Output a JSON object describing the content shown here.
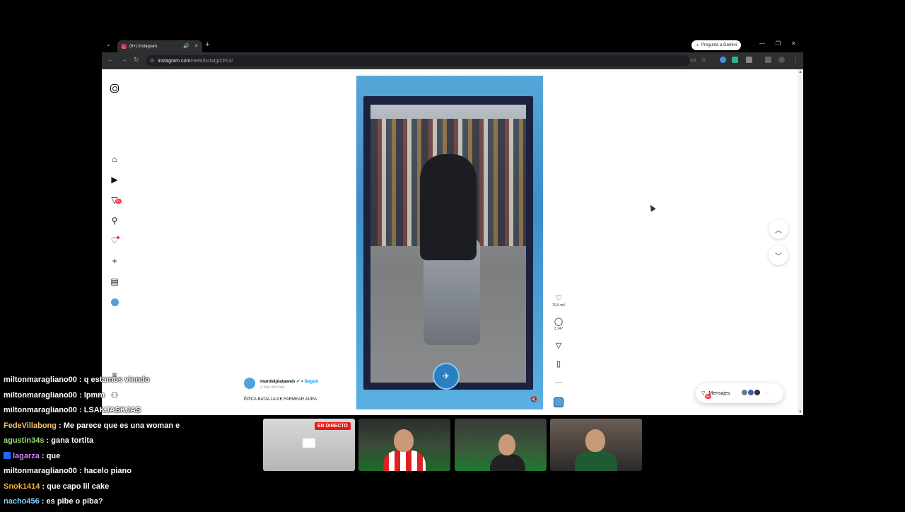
{
  "browser": {
    "tab_title": "(9+) Instagram",
    "gemini_label": "Pregunta a Gemini",
    "url_host": "instagram.com",
    "url_path": "/reels/DcIarjpCPc3/"
  },
  "instagram": {
    "sidebar": {
      "notifications_badge": "9+"
    },
    "reel": {
      "author": "mardelplataweb",
      "follow_label": "Seguir",
      "location": "Mar del Plata",
      "caption": "ÉPICA BATALLA DE FARMEAR AURA",
      "likes": "29,9 mil",
      "comments": "3.147",
      "more": "···"
    },
    "messages": {
      "label": "Mensajes",
      "badge": "9+"
    }
  },
  "chat": [
    {
      "user": "miltonmaragliano00",
      "message": "q estamos viendo",
      "color": "#ffffff",
      "prime": false
    },
    {
      "user": "miltonmaragliano00",
      "message": "lpmm",
      "color": "#ffffff",
      "prime": false
    },
    {
      "user": "miltonmaragliano00",
      "message": "LSAKJASKJAS",
      "color": "#ffffff",
      "prime": false
    },
    {
      "user": "FedeVillabong",
      "message": "Me parece que es una woman e",
      "color": "#f5c86b",
      "prime": false
    },
    {
      "user": "agustin34s",
      "message": "gana tortita",
      "color": "#9be36b",
      "prime": false
    },
    {
      "user": "lagarza",
      "message": "que",
      "color": "#d77bff",
      "prime": true
    },
    {
      "user": "miltonmaragliano00",
      "message": "hacelo piano",
      "color": "#ffffff",
      "prime": false
    },
    {
      "user": "Snok1414",
      "message": "que capo lil cake",
      "color": "#f3b13c",
      "prime": false
    },
    {
      "user": "nacho456",
      "message": "es pibe o piba?",
      "color": "#7fd3ff",
      "prime": false
    }
  ],
  "cams": {
    "live_label": "EN DIRECTO"
  }
}
